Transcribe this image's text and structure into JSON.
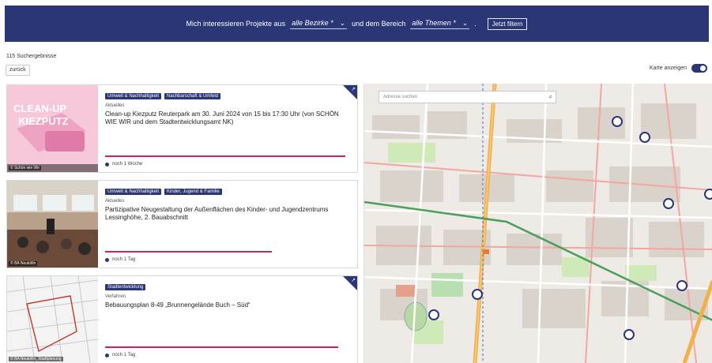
{
  "filter_bar": {
    "text_prefix": "Mich interessieren Projekte aus",
    "district_select": "alle Bezirke *",
    "text_middle": "und dem Bereich",
    "theme_select": "alle Themen *",
    "text_end": ".",
    "submit_label": "Jetzt filtern"
  },
  "results": {
    "count_text": "115 Suchergebnisse",
    "reset_label": "zurück"
  },
  "map_toggle": {
    "label": "Karte anzeigen"
  },
  "cards": [
    {
      "image_caption": "© Schön wie Wir",
      "image_text": "CLEAN-UP KIEZPUTZ",
      "tags": [
        "Umwelt & Nachhaltigkeit",
        "Nachbarschaft & Umfeld"
      ],
      "kind": "Aktuelles",
      "title": "Clean-up Kiezputz Reuterpark am 30. Juni 2024 von 15 bis 17:30 Uhr (von SCHÖN WIE WIR und dem Stadtentwicklungsamt NK)",
      "status": "noch 1 Woche",
      "progress": 0.98,
      "has_corner": true
    },
    {
      "image_caption": "© BA Neukölln",
      "image_text": "",
      "tags": [
        "Umwelt & Nachhaltigkeit",
        "Kinder, Jugend & Familie"
      ],
      "kind": "Aktuelles",
      "title": "Partizipative Neugestaltung der Außenflächen des Kinder- und Jugendzentrums Lessinghöhe, 2. Bauabschnitt",
      "status": "noch 1 Tag",
      "progress": 0.68,
      "has_corner": false
    },
    {
      "image_caption": "© BA Neukölln, Stadtplanung",
      "image_text": "",
      "tags": [
        "Stadtentwicklung"
      ],
      "kind": "Verfahren",
      "title": "Bebauungsplan 8-49 „Brunnengelände Buch – Süd“",
      "status": "noch 1 Tag",
      "progress": 0.95,
      "has_corner": true
    }
  ],
  "map": {
    "search_placeholder": "Adresse suchen",
    "search_icon": "search-icon",
    "marker_icon": "map-pin-icon"
  },
  "colors": {
    "primary": "#2a3675",
    "accent": "#d21f63"
  }
}
